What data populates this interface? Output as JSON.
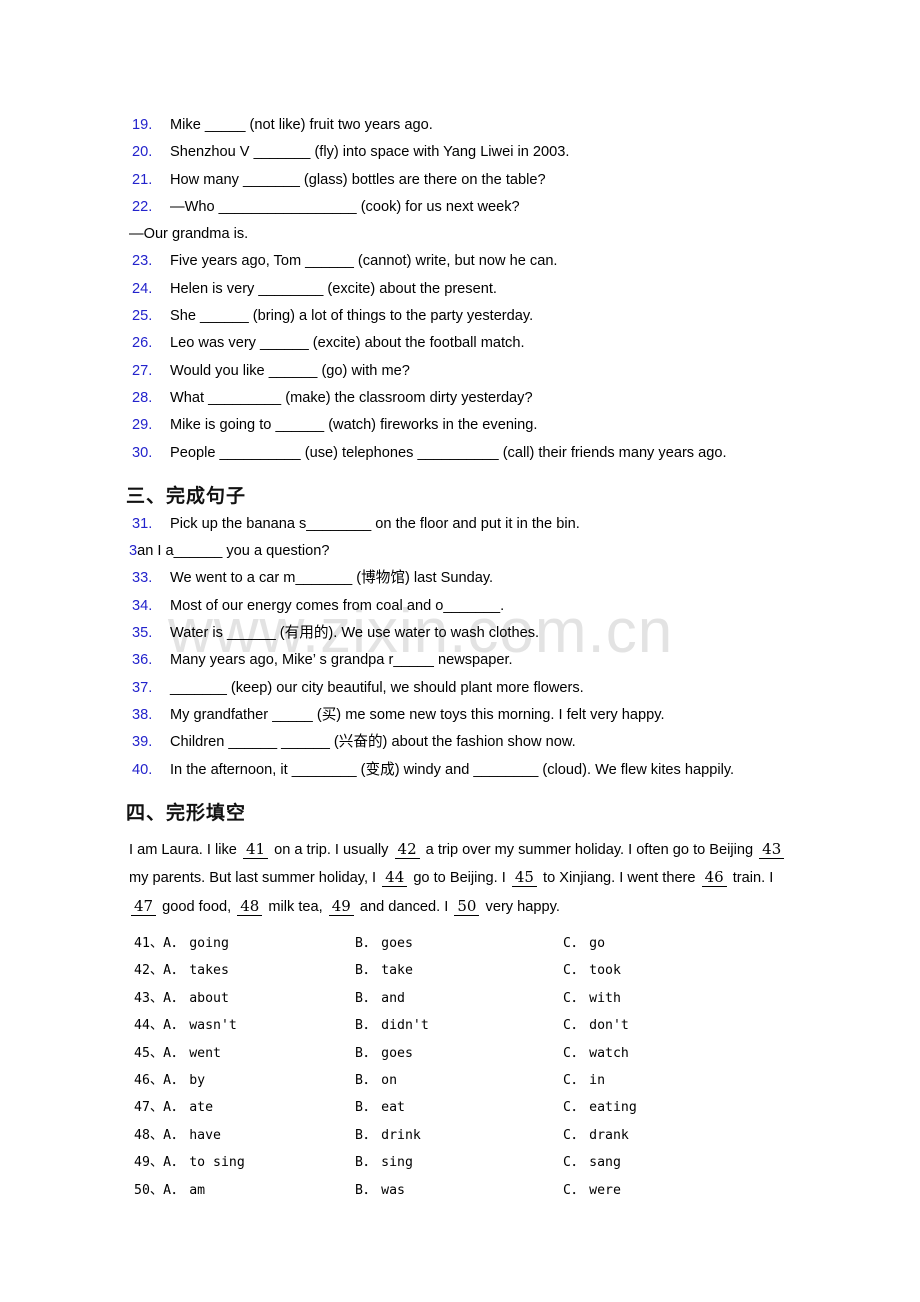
{
  "watermark": {
    "text": "www.zixin.com.cn"
  },
  "section_two": {
    "questions": [
      {
        "num": "19.",
        "text": "Mike _____ (not like) fruit two years ago."
      },
      {
        "num": "20.",
        "text": "Shenzhou V _______ (fly) into space with Yang Liwei in 2003."
      },
      {
        "num": "21.",
        "text": "How many _______ (glass) bottles are there on the table?"
      },
      {
        "num": "22.",
        "text": "—Who _________________ (cook) for us next week?"
      }
    ],
    "continuation": "—Our grandma is.",
    "questions_cont": [
      {
        "num": "23.",
        "text": "Five years ago, Tom ______ (cannot) write, but now he can."
      },
      {
        "num": "24.",
        "text": "Helen is very ________ (excite) about the present."
      },
      {
        "num": "25.",
        "text": "She ______ (bring) a lot of things to the party yesterday."
      },
      {
        "num": "26.",
        "text": "Leo was very ______ (excite) about the football match."
      },
      {
        "num": "27.",
        "text": "Would you like ______ (go) with me?"
      },
      {
        "num": "28.",
        "text": "What _________ (make) the classroom dirty yesterday?"
      },
      {
        "num": "29.",
        "text": "Mike is going to ______ (watch) fireworks in the evening."
      },
      {
        "num": "30.",
        "text": "People __________ (use) telephones __________ (call) their friends many years ago."
      }
    ]
  },
  "section_three": {
    "heading": "三、完成句子",
    "questions": [
      {
        "num": "31.",
        "text": "Pick up the banana s________ on the floor and put it in the bin."
      },
      {
        "num": "3",
        "text": "an I a______ you a question?",
        "inline_num": true
      },
      {
        "num": "33.",
        "text": "We went to a car m_______ (博物馆) last Sunday."
      },
      {
        "num": "34.",
        "text": "Most of our energy comes from coal and o_______."
      },
      {
        "num": "35.",
        "text": "Water is ______ (有用的). We use water to wash clothes."
      },
      {
        "num": "36.",
        "text": "Many years ago, Mike’ s grandpa r_____ newspaper."
      },
      {
        "num": "37.",
        "text": "_______ (keep) our city beautiful, we should plant more flowers."
      },
      {
        "num": "38.",
        "text": "My grandfather _____ (买) me some new toys this morning. I felt very happy."
      },
      {
        "num": "39.",
        "text": "Children ______ ______ (兴奋的) about the fashion show now."
      },
      {
        "num": "40.",
        "text": "In the afternoon, it ________ (变成) windy and ________ (cloud). We flew kites happily."
      }
    ]
  },
  "section_four": {
    "heading": "四、完形填空",
    "passage": [
      {
        "kind": "text",
        "value": "I am Laura. I like "
      },
      {
        "kind": "blank",
        "value": "41"
      },
      {
        "kind": "text",
        "value": " on a trip. I usually "
      },
      {
        "kind": "blank",
        "value": "42"
      },
      {
        "kind": "text",
        "value": " a trip over my summer holiday. I often go to Beijing "
      },
      {
        "kind": "blank",
        "value": "43"
      },
      {
        "kind": "text",
        "value": " my parents. But last summer holiday, I "
      },
      {
        "kind": "blank",
        "value": "44"
      },
      {
        "kind": "text",
        "value": " go to Beijing. I "
      },
      {
        "kind": "blank",
        "value": "45"
      },
      {
        "kind": "text",
        "value": " to Xinjiang. I went there "
      },
      {
        "kind": "blank",
        "value": "46"
      },
      {
        "kind": "text",
        "value": " train. I "
      },
      {
        "kind": "blank",
        "value": "47"
      },
      {
        "kind": "text",
        "value": " good food, "
      },
      {
        "kind": "blank",
        "value": "48"
      },
      {
        "kind": "text",
        "value": " milk tea, "
      },
      {
        "kind": "blank",
        "value": "49"
      },
      {
        "kind": "text",
        "value": " and danced. I "
      },
      {
        "kind": "blank",
        "value": "50"
      },
      {
        "kind": "text",
        "value": " very happy."
      }
    ],
    "options": [
      {
        "num": "41、",
        "a_key": "A．",
        "a": "going",
        "b_key": "B．",
        "b": "goes",
        "c_key": "C．",
        "c": "go"
      },
      {
        "num": "42、",
        "a_key": "A．",
        "a": "takes",
        "b_key": "B．",
        "b": "take",
        "c_key": "C．",
        "c": "took"
      },
      {
        "num": "43、",
        "a_key": "A．",
        "a": "about",
        "b_key": "B．",
        "b": "and",
        "c_key": "C．",
        "c": "with"
      },
      {
        "num": "44、",
        "a_key": "A．",
        "a": "wasn't",
        "b_key": "B．",
        "b": "didn't",
        "c_key": "C．",
        "c": "don't"
      },
      {
        "num": "45、",
        "a_key": "A．",
        "a": "went",
        "b_key": "B．",
        "b": "goes",
        "c_key": "C．",
        "c": "watch"
      },
      {
        "num": "46、",
        "a_key": "A．",
        "a": "by",
        "b_key": "B．",
        "b": "on",
        "c_key": "C．",
        "c": "in"
      },
      {
        "num": "47、",
        "a_key": "A．",
        "a": "ate",
        "b_key": "B．",
        "b": "eat",
        "c_key": "C．",
        "c": "eating"
      },
      {
        "num": "48、",
        "a_key": "A．",
        "a": "have",
        "b_key": "B．",
        "b": "drink",
        "c_key": "C．",
        "c": "drank"
      },
      {
        "num": "49、",
        "a_key": "A．",
        "a": "to sing",
        "b_key": "B．",
        "b": "sing",
        "c_key": "C．",
        "c": "sang"
      },
      {
        "num": "50、",
        "a_key": "A．",
        "a": "am",
        "b_key": "B．",
        "b": "was",
        "c_key": "C．",
        "c": "were"
      }
    ]
  },
  "colors": {
    "number_blue": "#2323cc",
    "text_black": "#000000",
    "watermark_gray": "#e3e3e3"
  }
}
